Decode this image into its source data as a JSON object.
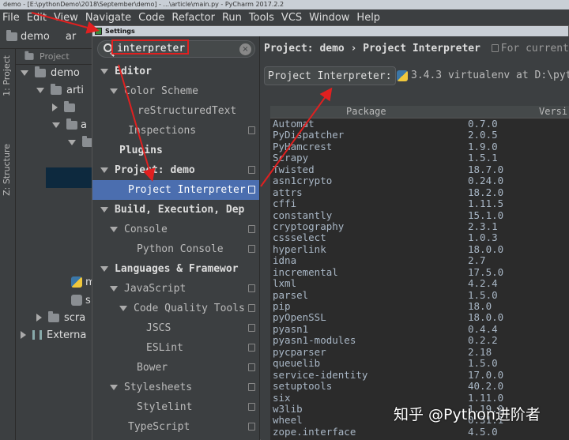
{
  "window": {
    "title": "demo - [E:\\pythonDemo\\2018\\September\\demo] - ...\\article\\main.py - PyCharm 2017.2.2"
  },
  "menu": [
    "File",
    "Edit",
    "View",
    "Navigate",
    "Code",
    "Refactor",
    "Run",
    "Tools",
    "VCS",
    "Window",
    "Help"
  ],
  "nav": {
    "crumb1": "demo",
    "crumb2": "ar"
  },
  "side_tabs": {
    "project": "1: Project",
    "structure": "Z: Structure"
  },
  "project_panel": {
    "header": "Project",
    "rows": [
      "demo",
      "arti",
      "",
      "a",
      "",
      "m",
      "s",
      "scra",
      "Externa"
    ]
  },
  "dialog": {
    "title": "Settings"
  },
  "search": {
    "value": "interpreter",
    "clear_icon": "×"
  },
  "settings_tree": [
    {
      "label": "Editor",
      "expanded": true
    },
    {
      "label": "Color Scheme",
      "expanded": true
    },
    {
      "label": "reStructuredText"
    },
    {
      "label": "Inspections"
    },
    {
      "label": "Plugins"
    },
    {
      "label": "Project: demo",
      "expanded": true
    },
    {
      "label": "Project Interpreter",
      "selected": true
    },
    {
      "label": "Build, Execution, Dep",
      "expanded": true
    },
    {
      "label": "Console",
      "expanded": true
    },
    {
      "label": "Python Console"
    },
    {
      "label": "Languages & Framewor",
      "expanded": true
    },
    {
      "label": "JavaScript",
      "expanded": true
    },
    {
      "label": "Code Quality Tools",
      "expanded": true
    },
    {
      "label": "JSCS"
    },
    {
      "label": "ESLint"
    },
    {
      "label": "Bower"
    },
    {
      "label": "Stylesheets",
      "expanded": true
    },
    {
      "label": "Stylelint"
    },
    {
      "label": "TypeScript"
    }
  ],
  "right": {
    "breadcrumb_project": "Project: demo",
    "breadcrumb_sep": "›",
    "breadcrumb_page": "Project Interpreter",
    "breadcrumb_note": "For current",
    "interpreter_label": "Project Interpreter:",
    "interpreter_value": "3.4.3 virtualenv at D:\\pyth",
    "col_package": "Package",
    "col_version": "Versi"
  },
  "packages": [
    [
      "Automat",
      "0.7.0"
    ],
    [
      "PyDispatcher",
      "2.0.5"
    ],
    [
      "PyHamcrest",
      "1.9.0"
    ],
    [
      "Scrapy",
      "1.5.1"
    ],
    [
      "Twisted",
      "18.7.0"
    ],
    [
      "asn1crypto",
      "0.24.0"
    ],
    [
      "attrs",
      "18.2.0"
    ],
    [
      "cffi",
      "1.11.5"
    ],
    [
      "constantly",
      "15.1.0"
    ],
    [
      "cryptography",
      "2.3.1"
    ],
    [
      "cssselect",
      "1.0.3"
    ],
    [
      "hyperlink",
      "18.0.0"
    ],
    [
      "idna",
      "2.7"
    ],
    [
      "incremental",
      "17.5.0"
    ],
    [
      "lxml",
      "4.2.4"
    ],
    [
      "parsel",
      "1.5.0"
    ],
    [
      "pip",
      "18.0"
    ],
    [
      "pyOpenSSL",
      "18.0.0"
    ],
    [
      "pyasn1",
      "0.4.4"
    ],
    [
      "pyasn1-modules",
      "0.2.2"
    ],
    [
      "pycparser",
      "2.18"
    ],
    [
      "queuelib",
      "1.5.0"
    ],
    [
      "service-identity",
      "17.0.0"
    ],
    [
      "setuptools",
      "40.2.0"
    ],
    [
      "six",
      "1.11.0"
    ],
    [
      "w3lib",
      "1.19.0"
    ],
    [
      "wheel",
      "0.31.1"
    ],
    [
      "zope.interface",
      "4.5.0"
    ]
  ],
  "watermark": "知乎 @Python进阶者",
  "colors": {
    "accent": "#4b6eaf",
    "annotation": "#e02020",
    "background": "#3c3f41"
  }
}
